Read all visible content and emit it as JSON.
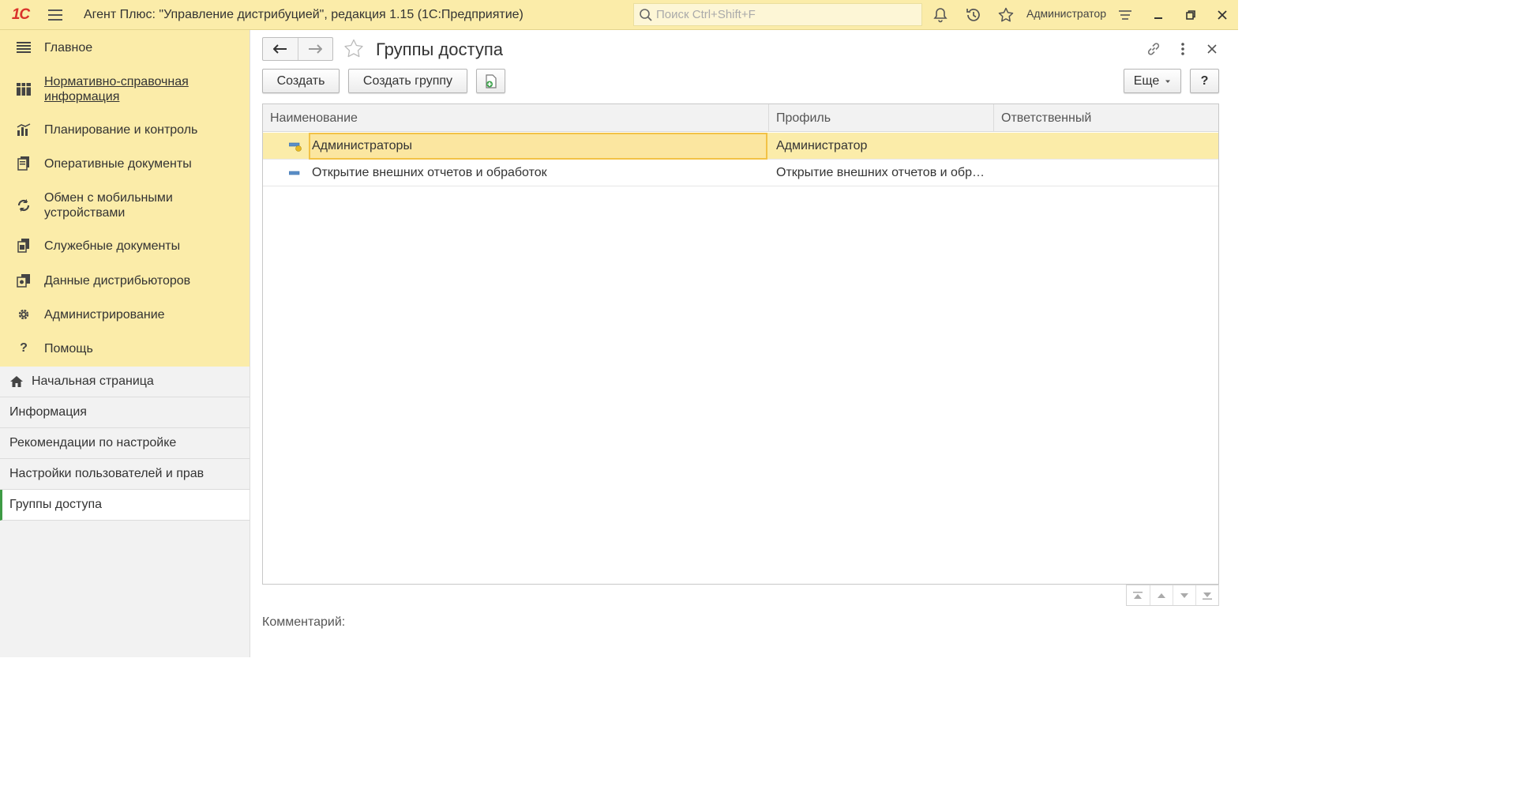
{
  "topbar": {
    "logo": "1С",
    "title": "Агент Плюс: \"Управление дистрибуцией\", редакция 1.15  (1С:Предприятие)",
    "search_placeholder": "Поиск Ctrl+Shift+F",
    "user": "Администратор",
    "icons": [
      "bell-icon",
      "history-icon",
      "star-icon",
      "settings-menu-icon",
      "minimize-icon",
      "restore-icon",
      "close-icon"
    ]
  },
  "sidebar": {
    "sections": [
      {
        "label": "Главное",
        "icon": "list-icon"
      },
      {
        "label": "Нормативно-справочная информация",
        "icon": "catalog-icon"
      },
      {
        "label": "Планирование и контроль",
        "icon": "chart-icon"
      },
      {
        "label": "Оперативные документы",
        "icon": "documents-icon"
      },
      {
        "label": "Обмен с мобильными устройствами",
        "icon": "sync-icon"
      },
      {
        "label": "Служебные документы",
        "icon": "service-docs-icon"
      },
      {
        "label": "Данные дистрибьюторов",
        "icon": "distributors-icon"
      },
      {
        "label": "Администрирование",
        "icon": "gear-icon"
      },
      {
        "label": "Помощь",
        "icon": "help-icon"
      }
    ],
    "open_windows": [
      {
        "label": "Начальная страница",
        "icon": "home-icon"
      },
      {
        "label": "Информация"
      },
      {
        "label": "Рекомендации по настройке"
      },
      {
        "label": "Настройки пользователей и прав"
      },
      {
        "label": "Группы доступа",
        "active": true
      }
    ]
  },
  "form": {
    "title": "Группы доступа",
    "buttons": {
      "create": "Создать",
      "create_group": "Создать группу",
      "more": "Еще",
      "help": "?"
    },
    "table": {
      "columns": [
        "Наименование",
        "Профиль",
        "Ответственный"
      ],
      "rows": [
        {
          "name": "Администраторы",
          "profile": "Администратор",
          "responsible": "",
          "selected": true
        },
        {
          "name": "Открытие внешних отчетов и обработок",
          "profile": "Открытие внешних отчетов и обр…",
          "responsible": ""
        }
      ]
    },
    "comment_label": "Комментарий:"
  },
  "colors": {
    "panel_yellow": "#fbeca9",
    "selection": "#fbe6a0",
    "focus_border": "#f2c246",
    "logo_red": "#d9322b",
    "active_marker": "#3e9b45"
  }
}
